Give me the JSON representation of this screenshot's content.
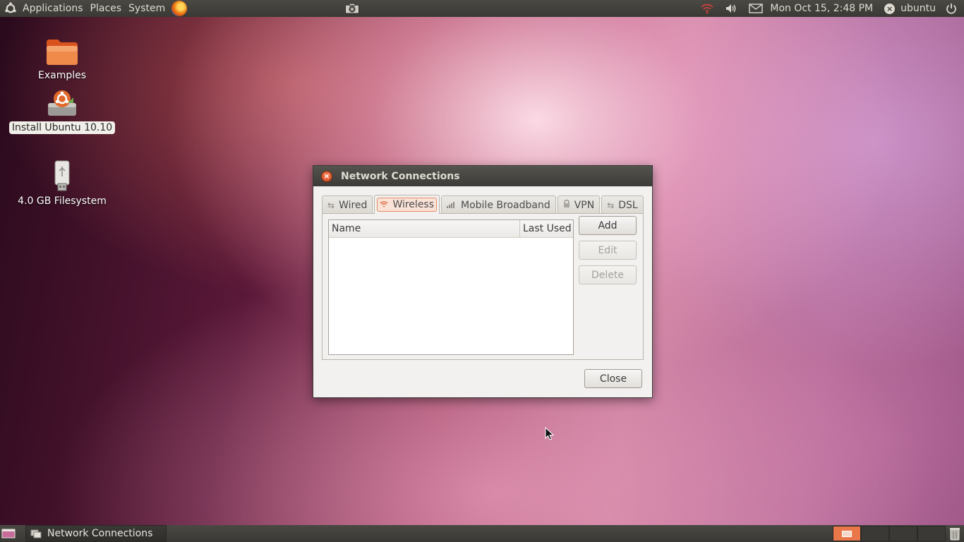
{
  "top_panel": {
    "menus": [
      "Applications",
      "Places",
      "System"
    ],
    "clock": "Mon Oct 15,  2:48 PM",
    "user": "ubuntu"
  },
  "desktop": {
    "icons": [
      {
        "label": "Examples"
      },
      {
        "label": "Install Ubuntu 10.10"
      },
      {
        "label": "4.0 GB Filesystem"
      }
    ]
  },
  "dialog": {
    "title": "Network Connections",
    "tabs": [
      "Wired",
      "Wireless",
      "Mobile Broadband",
      "VPN",
      "DSL"
    ],
    "active_tab": "Wireless",
    "columns": [
      "Name",
      "Last Used"
    ],
    "buttons": {
      "add": "Add",
      "edit": "Edit",
      "delete": "Delete",
      "close": "Close"
    }
  },
  "bottom_panel": {
    "task_label": "Network Connections"
  },
  "colors": {
    "accent": "#e9774a",
    "panel": "#3c3b37"
  }
}
